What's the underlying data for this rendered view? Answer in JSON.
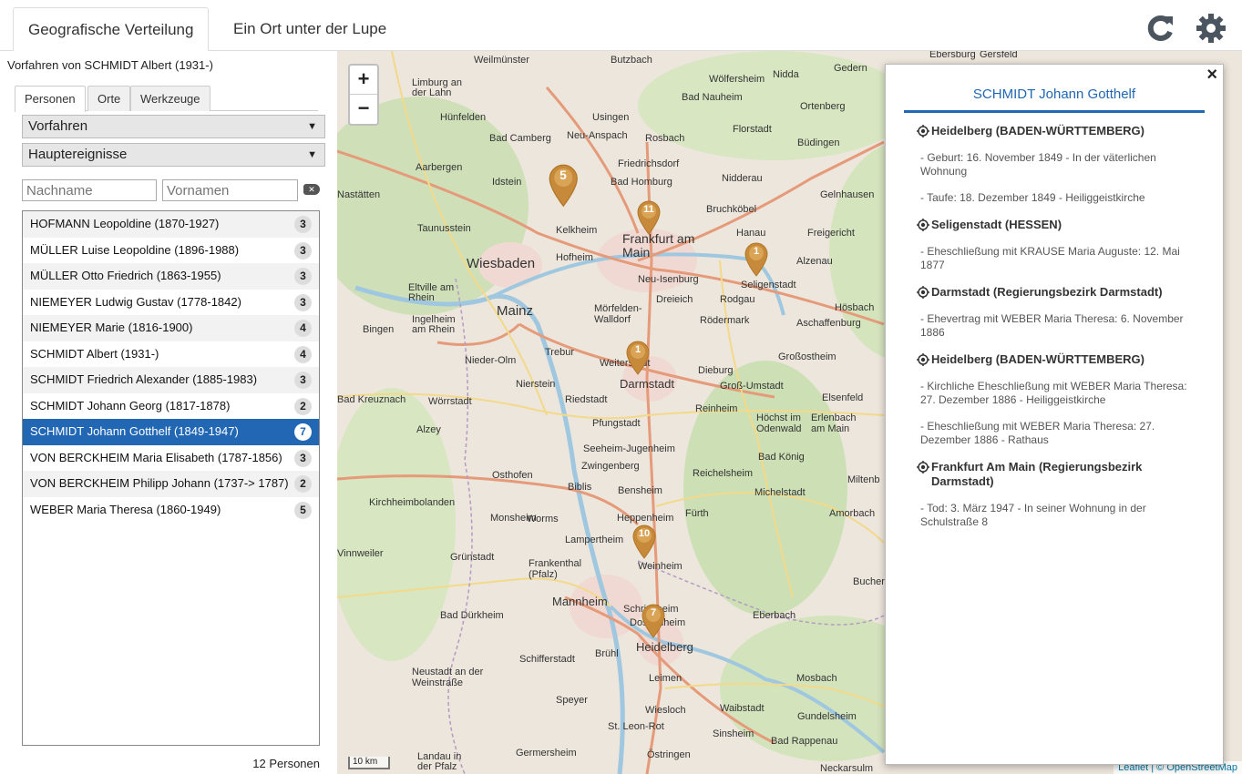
{
  "header": {
    "tabs": [
      "Geografische Verteilung",
      "Ein Ort unter der Lupe"
    ],
    "refresh_icon": "refresh-icon",
    "settings_icon": "gear-icon"
  },
  "sidebar": {
    "title": "Vorfahren von SCHMIDT Albert (1931-)",
    "subtabs": [
      "Personen",
      "Orte",
      "Werkzeuge"
    ],
    "select1": "Vorfahren",
    "select2": "Hauptereignisse",
    "surname_placeholder": "Nachname",
    "givennames_placeholder": "Vornamen",
    "persons": [
      {
        "name": "HOFMANN Leopoldine (1870-1927)",
        "count": "3"
      },
      {
        "name": "MÜLLER Luise Leopoldine (1896-1988)",
        "count": "3"
      },
      {
        "name": "MÜLLER Otto Friedrich (1863-1955)",
        "count": "3"
      },
      {
        "name": "NIEMEYER Ludwig Gustav (1778-1842)",
        "count": "3"
      },
      {
        "name": "NIEMEYER Marie (1816-1900)",
        "count": "4"
      },
      {
        "name": "SCHMIDT Albert (1931-)",
        "count": "4"
      },
      {
        "name": "SCHMIDT Friedrich Alexander (1885-1983)",
        "count": "3"
      },
      {
        "name": "SCHMIDT Johann Georg (1817-1878)",
        "count": "2"
      },
      {
        "name": "SCHMIDT Johann Gotthelf (1849-1947)",
        "count": "7"
      },
      {
        "name": "VON BERCKHEIM Maria Elisabeth (1787-1856)",
        "count": "3"
      },
      {
        "name": "VON BERCKHEIM Philipp Johann (1737-> 1787)",
        "count": "2"
      },
      {
        "name": "WEBER Maria Theresa (1860-1949)",
        "count": "5"
      }
    ],
    "selected_index": 8,
    "person_count": "12 Personen"
  },
  "map": {
    "zoom_in": "+",
    "zoom_out": "−",
    "scale": "10 km",
    "attribution": "Leaflet | © OpenStreetMap",
    "places": [
      "Weilmünster",
      "Butzbach",
      "Nidda",
      "Gedern",
      "Limburg an der Lahn",
      "Wölfersheim",
      "Bad Nauheim",
      "Ortenberg",
      "Hünfelden",
      "Usingen",
      "Florstadt",
      "Bad Camberg",
      "Neu-Anspach",
      "Rosbach",
      "Büdingen",
      "Friedrichsdorf",
      "Aarbergen",
      "Idstein",
      "Bad Homburg",
      "Nidderau",
      "Nastätten",
      "Gelnhausen",
      "Taunusstein",
      "Kelkheim",
      "Frankfurt am Main",
      "Bruchköbel",
      "Hanau",
      "Freigericht",
      "Wiesbaden",
      "Hofheim",
      "Alzenau",
      "Eltville am Rhein",
      "Neu-Isenburg",
      "Dreieich",
      "Rodgau",
      "Seligenstadt",
      "Mainz",
      "Mörfelden-Walldorf",
      "Hösbach",
      "Ingelheim am Rhein",
      "Bingen",
      "Rödermark",
      "Aschaffenburg",
      "Trebur",
      "Nieder-Olm",
      "Weiterstadt",
      "Dieburg",
      "Großostheim",
      "Darmstadt",
      "Nierstein",
      "Groß-Umstadt",
      "Riedstadt",
      "Bad Kreuznach",
      "Wörrstadt",
      "Reinheim",
      "Elsenfeld",
      "Pfungstadt",
      "Höchst im Odenwald",
      "Erlenbach am Main",
      "Seeheim-Jugenheim",
      "Alzey",
      "Bad König",
      "Zwingenberg",
      "Osthofen",
      "Reichelsheim",
      "Biblis",
      "Bensheim",
      "Michelstadt",
      "Kirchheimbolanden",
      "Monsheim",
      "Worms",
      "Heppenheim",
      "Fürth",
      "Amorbach",
      "Lampertheim",
      "Grünstadt",
      "Frankenthal (Pfalz)",
      "Weinheim",
      "Mannheim",
      "Schriesheim",
      "Bad Dürkheim",
      "Dossenheim",
      "Eberbach",
      "Heidelberg",
      "Schifferstadt",
      "Brühl",
      "Neustadt an der Weinstraße",
      "Leimen",
      "Mosbach",
      "Speyer",
      "Wiesloch",
      "Waibstadt",
      "Gundelsheim",
      "St. Leon-Rot",
      "Sinsheim",
      "Bad Rappenau",
      "Germersheim",
      "Östringen",
      "Landau in der Pfalz",
      "Neckarsulm",
      "Ebersburg",
      "Gersfeld",
      "Vinnweiler",
      "Bucher",
      "Miltenb"
    ],
    "markers": [
      {
        "label": "5"
      },
      {
        "label": "11"
      },
      {
        "label": "1"
      },
      {
        "label": "1"
      },
      {
        "label": "10"
      },
      {
        "label": "7"
      }
    ]
  },
  "popup": {
    "close": "×",
    "title": "SCHMIDT Johann Gotthelf",
    "locations": [
      {
        "place": "Heidelberg (BADEN-WÜRTTEMBERG)",
        "events": [
          "- Geburt: 16. November 1849 - In der väterlichen Wohnung",
          "- Taufe: 18. Dezember 1849 - Heiliggeistkirche"
        ]
      },
      {
        "place": "Seligenstadt (HESSEN)",
        "events": [
          "- Eheschließung mit KRAUSE Maria Auguste: 12. Mai 1877"
        ]
      },
      {
        "place": "Darmstadt (Regierungsbezirk Darmstadt)",
        "events": [
          "- Ehevertrag mit WEBER Maria Theresa: 6. November 1886"
        ]
      },
      {
        "place": "Heidelberg (BADEN-WÜRTTEMBERG)",
        "events": [
          "- Kirchliche Eheschließung mit WEBER Maria Theresa: 27. Dezember 1886 - Heiliggeistkirche",
          "- Eheschließung mit WEBER Maria Theresa: 27. Dezember 1886 - Rathaus"
        ]
      },
      {
        "place": "Frankfurt Am Main (Regierungsbezirk Darmstadt)",
        "events": [
          "- Tod: 3. März 1947 - In seiner Wohnung in der Schulstraße 8"
        ]
      }
    ]
  }
}
